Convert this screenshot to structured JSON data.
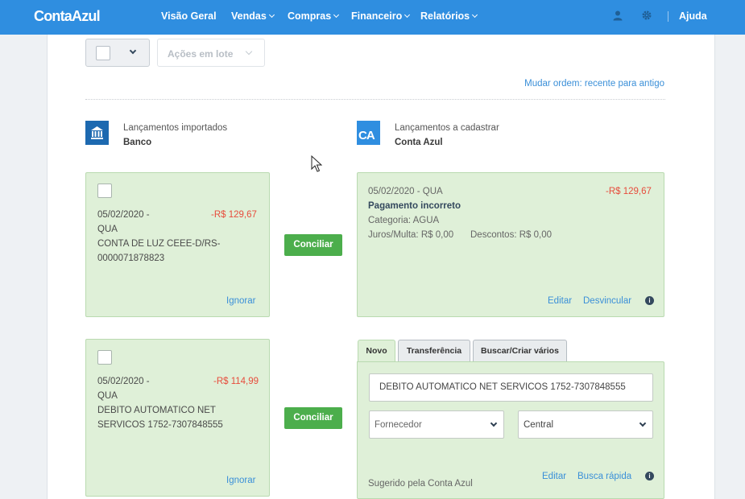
{
  "header": {
    "logo": "ContaAzul",
    "nav": [
      {
        "label": "Visão Geral",
        "dropdown": false
      },
      {
        "label": "Vendas",
        "dropdown": true
      },
      {
        "label": "Compras",
        "dropdown": true
      },
      {
        "label": "Financeiro",
        "dropdown": true
      },
      {
        "label": "Relatórios",
        "dropdown": true
      }
    ],
    "icons": [
      "user-icon",
      "gear-icon"
    ],
    "help": "Ajuda"
  },
  "toolbar": {
    "batch_actions": "Ações em lote",
    "change_order": "Mudar ordem: recente para antigo"
  },
  "columns": {
    "left": {
      "title": "Lançamentos importados",
      "subtitle": "Banco",
      "icon": "bank-icon"
    },
    "right": {
      "title": "Lançamentos a cadastrar",
      "subtitle": "Conta Azul",
      "icon_text": "CA"
    }
  },
  "rows": [
    {
      "imported": {
        "date_line1": "05/02/2020 -",
        "date_line2": "QUA",
        "amount": "-R$ 129,67",
        "desc_line1": "CONTA DE LUZ CEEE-D/RS-",
        "desc_line2": "0000071878823",
        "ignore": "Ignorar"
      },
      "conciliate": "Conciliar",
      "match": {
        "date": "05/02/2020 - QUA",
        "amount": "-R$ 129,67",
        "title": "Pagamento incorreto",
        "category": "Categoria: AGUA",
        "interest": "Juros/Multa: R$ 0,00",
        "discounts": "Descontos: R$ 0,00",
        "edit": "Editar",
        "unlink": "Desvincular"
      }
    },
    {
      "imported": {
        "date_line1": "05/02/2020 -",
        "date_line2": "QUA",
        "amount": "-R$ 114,99",
        "desc_line1": "DEBITO AUTOMATICO NET",
        "desc_line2": "SERVICOS 1752-7307848555",
        "ignore": "Ignorar"
      },
      "conciliate": "Conciliar",
      "new_form": {
        "tabs": [
          "Novo",
          "Transferência",
          "Buscar/Criar vários"
        ],
        "active_tab": "Novo",
        "description": "DEBITO AUTOMATICO NET SERVICOS 1752-7307848555",
        "supplier_placeholder": "Fornecedor",
        "cost_center": "Central",
        "suggested": "Sugerido pela Conta Azul",
        "edit": "Editar",
        "quick_search": "Busca rápida"
      }
    }
  ]
}
